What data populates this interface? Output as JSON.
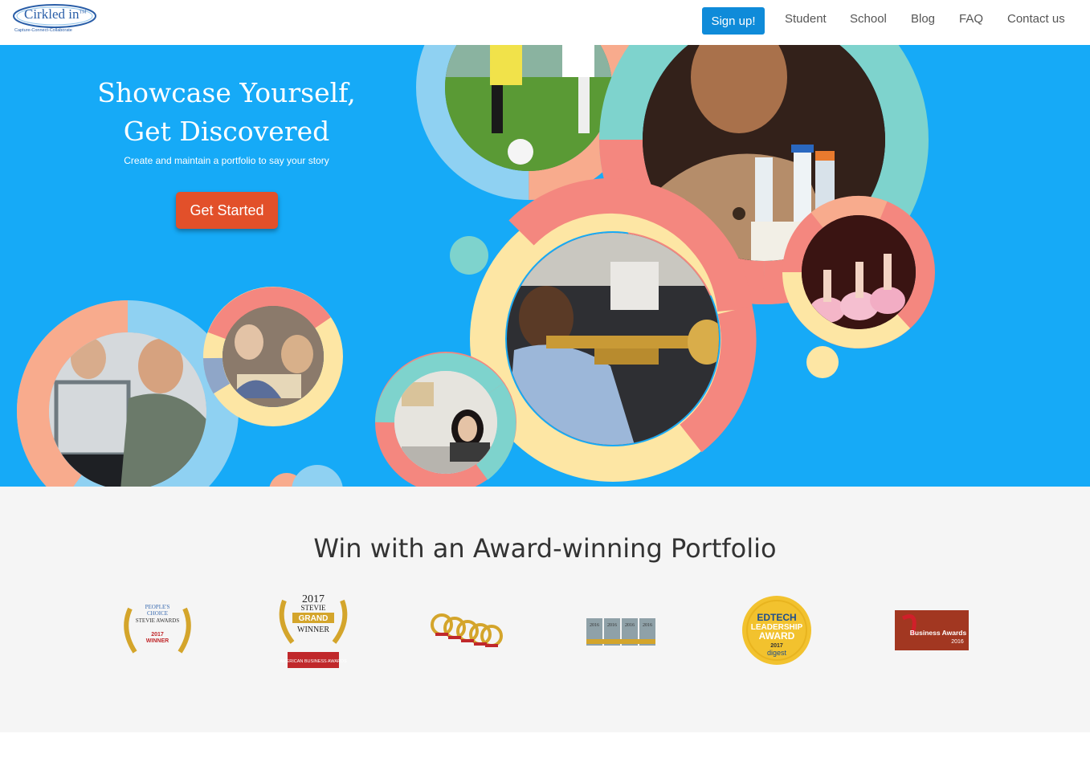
{
  "brand": {
    "name": "Cirkled in",
    "tm": "TM",
    "tagline": "Capture-Connect-Collaborate"
  },
  "nav": {
    "signup_label": "Sign up!",
    "links": [
      "Student",
      "School",
      "Blog",
      "FAQ",
      "Contact us"
    ]
  },
  "hero": {
    "title_line1": "Showcase Yourself,",
    "title_line2": "Get Discovered",
    "subtitle": "Create and maintain a portfolio to say your story",
    "cta_label": "Get Started"
  },
  "awards": {
    "heading": "Win with an Award-winning Portfolio",
    "items": [
      {
        "icon": "peoples-choice-stevie-award-icon",
        "lines": [
          "PEOPLE'S",
          "CHOICE",
          "STEVIE AWARDS",
          "2017",
          "WINNER"
        ]
      },
      {
        "icon": "stevie-grand-winner-icon",
        "lines": [
          "2017",
          "STEVIE",
          "GRAND",
          "WINNER",
          "AMERICAN BUSINESS AWARDS"
        ]
      },
      {
        "icon": "stevie-winner-stack-icon",
        "lines": []
      },
      {
        "icon": "stevie-2016-awards-icon",
        "lines": [
          "2016",
          "2016",
          "2016",
          "2016"
        ]
      },
      {
        "icon": "edtech-leadership-award-icon",
        "lines": [
          "EDTECH",
          "LEADERSHIP",
          "AWARD",
          "2017",
          "digest"
        ]
      },
      {
        "icon": "business-awards-2016-icon",
        "lines": [
          "Business Awards",
          "2016"
        ]
      }
    ]
  },
  "colors": {
    "hero_bg": "#16aaf7",
    "signup_bg": "#0f8bd9",
    "cta_bg": "#e2502a",
    "ring_salmon": "#f4877f",
    "ring_light_blue": "#8fd1f2",
    "ring_yellow": "#fde6a4",
    "ring_teal": "#7ed3cd",
    "ring_peach": "#f8ab8d"
  }
}
